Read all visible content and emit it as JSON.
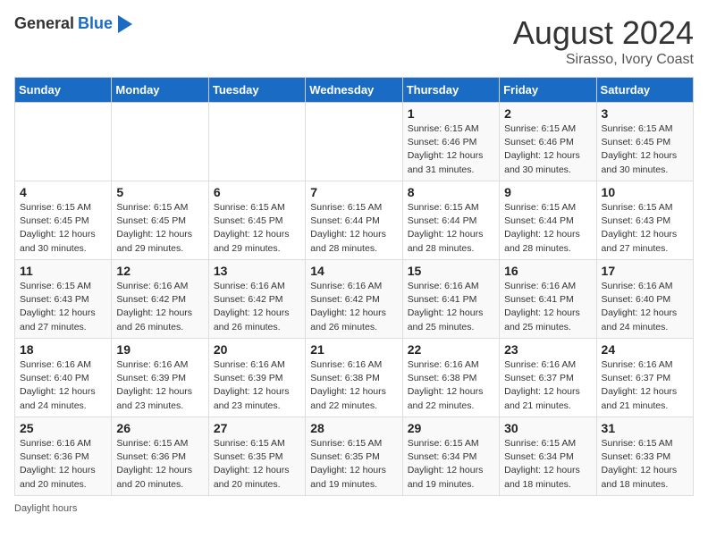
{
  "header": {
    "logo_general": "General",
    "logo_blue": "Blue",
    "title": "August 2024",
    "subtitle": "Sirasso, Ivory Coast"
  },
  "columns": [
    "Sunday",
    "Monday",
    "Tuesday",
    "Wednesday",
    "Thursday",
    "Friday",
    "Saturday"
  ],
  "weeks": [
    [
      {
        "day": "",
        "info": ""
      },
      {
        "day": "",
        "info": ""
      },
      {
        "day": "",
        "info": ""
      },
      {
        "day": "",
        "info": ""
      },
      {
        "day": "1",
        "info": "Sunrise: 6:15 AM\nSunset: 6:46 PM\nDaylight: 12 hours and 31 minutes."
      },
      {
        "day": "2",
        "info": "Sunrise: 6:15 AM\nSunset: 6:46 PM\nDaylight: 12 hours and 30 minutes."
      },
      {
        "day": "3",
        "info": "Sunrise: 6:15 AM\nSunset: 6:45 PM\nDaylight: 12 hours and 30 minutes."
      }
    ],
    [
      {
        "day": "4",
        "info": "Sunrise: 6:15 AM\nSunset: 6:45 PM\nDaylight: 12 hours and 30 minutes."
      },
      {
        "day": "5",
        "info": "Sunrise: 6:15 AM\nSunset: 6:45 PM\nDaylight: 12 hours and 29 minutes."
      },
      {
        "day": "6",
        "info": "Sunrise: 6:15 AM\nSunset: 6:45 PM\nDaylight: 12 hours and 29 minutes."
      },
      {
        "day": "7",
        "info": "Sunrise: 6:15 AM\nSunset: 6:44 PM\nDaylight: 12 hours and 28 minutes."
      },
      {
        "day": "8",
        "info": "Sunrise: 6:15 AM\nSunset: 6:44 PM\nDaylight: 12 hours and 28 minutes."
      },
      {
        "day": "9",
        "info": "Sunrise: 6:15 AM\nSunset: 6:44 PM\nDaylight: 12 hours and 28 minutes."
      },
      {
        "day": "10",
        "info": "Sunrise: 6:15 AM\nSunset: 6:43 PM\nDaylight: 12 hours and 27 minutes."
      }
    ],
    [
      {
        "day": "11",
        "info": "Sunrise: 6:15 AM\nSunset: 6:43 PM\nDaylight: 12 hours and 27 minutes."
      },
      {
        "day": "12",
        "info": "Sunrise: 6:16 AM\nSunset: 6:42 PM\nDaylight: 12 hours and 26 minutes."
      },
      {
        "day": "13",
        "info": "Sunrise: 6:16 AM\nSunset: 6:42 PM\nDaylight: 12 hours and 26 minutes."
      },
      {
        "day": "14",
        "info": "Sunrise: 6:16 AM\nSunset: 6:42 PM\nDaylight: 12 hours and 26 minutes."
      },
      {
        "day": "15",
        "info": "Sunrise: 6:16 AM\nSunset: 6:41 PM\nDaylight: 12 hours and 25 minutes."
      },
      {
        "day": "16",
        "info": "Sunrise: 6:16 AM\nSunset: 6:41 PM\nDaylight: 12 hours and 25 minutes."
      },
      {
        "day": "17",
        "info": "Sunrise: 6:16 AM\nSunset: 6:40 PM\nDaylight: 12 hours and 24 minutes."
      }
    ],
    [
      {
        "day": "18",
        "info": "Sunrise: 6:16 AM\nSunset: 6:40 PM\nDaylight: 12 hours and 24 minutes."
      },
      {
        "day": "19",
        "info": "Sunrise: 6:16 AM\nSunset: 6:39 PM\nDaylight: 12 hours and 23 minutes."
      },
      {
        "day": "20",
        "info": "Sunrise: 6:16 AM\nSunset: 6:39 PM\nDaylight: 12 hours and 23 minutes."
      },
      {
        "day": "21",
        "info": "Sunrise: 6:16 AM\nSunset: 6:38 PM\nDaylight: 12 hours and 22 minutes."
      },
      {
        "day": "22",
        "info": "Sunrise: 6:16 AM\nSunset: 6:38 PM\nDaylight: 12 hours and 22 minutes."
      },
      {
        "day": "23",
        "info": "Sunrise: 6:16 AM\nSunset: 6:37 PM\nDaylight: 12 hours and 21 minutes."
      },
      {
        "day": "24",
        "info": "Sunrise: 6:16 AM\nSunset: 6:37 PM\nDaylight: 12 hours and 21 minutes."
      }
    ],
    [
      {
        "day": "25",
        "info": "Sunrise: 6:16 AM\nSunset: 6:36 PM\nDaylight: 12 hours and 20 minutes."
      },
      {
        "day": "26",
        "info": "Sunrise: 6:15 AM\nSunset: 6:36 PM\nDaylight: 12 hours and 20 minutes."
      },
      {
        "day": "27",
        "info": "Sunrise: 6:15 AM\nSunset: 6:35 PM\nDaylight: 12 hours and 20 minutes."
      },
      {
        "day": "28",
        "info": "Sunrise: 6:15 AM\nSunset: 6:35 PM\nDaylight: 12 hours and 19 minutes."
      },
      {
        "day": "29",
        "info": "Sunrise: 6:15 AM\nSunset: 6:34 PM\nDaylight: 12 hours and 19 minutes."
      },
      {
        "day": "30",
        "info": "Sunrise: 6:15 AM\nSunset: 6:34 PM\nDaylight: 12 hours and 18 minutes."
      },
      {
        "day": "31",
        "info": "Sunrise: 6:15 AM\nSunset: 6:33 PM\nDaylight: 12 hours and 18 minutes."
      }
    ]
  ],
  "footer": {
    "daylight_label": "Daylight hours"
  }
}
